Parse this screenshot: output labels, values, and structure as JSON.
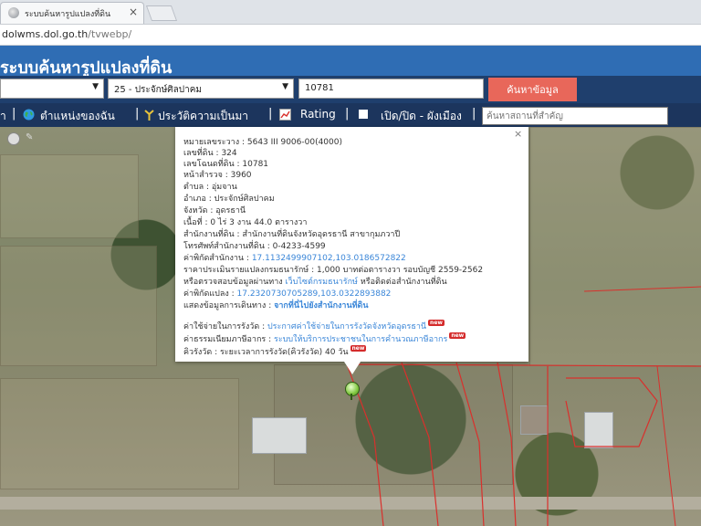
{
  "browser": {
    "tab_title": "ระบบค้นหารูปแปลงที่ดิน",
    "url_host": "dolwms.dol.go.th",
    "url_path": "/tvwebp/"
  },
  "header": {
    "title": "ระบบค้นหารูปแปลงที่ดิน"
  },
  "search": {
    "province_value": "",
    "district_value": "25 - ประจักษ์ศิลปาคม",
    "deed_number": "10781",
    "submit_label": "ค้นหาข้อมูล"
  },
  "toolbar": {
    "item1_label": "า",
    "my_location_label": "ตำแหน่งของฉัน",
    "history_label": "ประวัติความเป็นมา",
    "rating_label": "Rating",
    "toggle_layer_label": "เปิด/ปิด - ผังเมือง",
    "place_placeholder": "ค้นหาสถานที่สำคัญ"
  },
  "popup": {
    "close": "×",
    "map_sheet": {
      "label": "หมายเลขระวาง",
      "value": "5643 III 9006-00(4000)"
    },
    "parcel_no": {
      "label": "เลขที่ดิน",
      "value": "324"
    },
    "deed_no": {
      "label": "เลขโฉนดที่ดิน",
      "value": "10781"
    },
    "survey_page": {
      "label": "หน้าสำรวจ",
      "value": "3960"
    },
    "subdistrict": {
      "label": "ตำบล",
      "value": "อุ่มจาน"
    },
    "district": {
      "label": "อำเภอ",
      "value": "ประจักษ์ศิลปาคม"
    },
    "province": {
      "label": "จังหวัด",
      "value": "อุดรธานี"
    },
    "area": {
      "label": "เนื้อที่",
      "value": "0 ไร่ 3 งาน 44.0 ตารางวา"
    },
    "office": {
      "label": "สำนักงานที่ดิน",
      "value": "สำนักงานที่ดินจังหวัดอุดรธานี สาขากุมภวาปี"
    },
    "office_phone": {
      "label": "โทรศัพท์สำนักงานที่ดิน",
      "value": "0-4233-4599"
    },
    "office_coords": {
      "label": "ค่าพิกัดสำนักงาน",
      "value": "17.1132499907102,103.0186572822"
    },
    "appraisal": {
      "label": "ราคาประเมินรายแปลงกรมธนารักษ์",
      "value": "1,000 บาทต่อตารางวา รอบบัญชี 2559-2562"
    },
    "verify": {
      "label": "หรือตรวจสอบข้อมูลผ่านทาง",
      "link": "เว็บไซต์กรมธนารักษ์",
      "suffix": "หรือติดต่อสำนักงานที่ดิน"
    },
    "parcel_coords": {
      "label": "ค่าพิกัดแปลง",
      "value": "17.2320730705289,103.0322893882"
    },
    "route": {
      "label": "แสดงข้อมูลการเดินทาง",
      "link": "จากที่นี่ไปยังสำนักงานที่ดิน"
    },
    "fee": {
      "label": "ค่าใช้จ่ายในการรังวัด",
      "link": "ประกาศค่าใช้จ่ายในการรังวัดจังหวัดอุดรธานี",
      "badge": "new"
    },
    "tax": {
      "label": "ค่าธรรมเนียมภาษีอากร",
      "link": "ระบบให้บริการประชาชนในการคำนวณภาษีอากร",
      "badge": "new"
    },
    "queue": {
      "label": "คิวรังวัด",
      "value": "ระยะเวลาการรังวัด(คิวรังวัด) 40 วัน",
      "badge": "new"
    }
  },
  "colors": {
    "header_blue": "#2f6db4",
    "toolbar_navy": "#1c355d",
    "search_button": "#e8675a",
    "link_blue": "#3a86d8",
    "parcel_line": "#d9302c"
  }
}
